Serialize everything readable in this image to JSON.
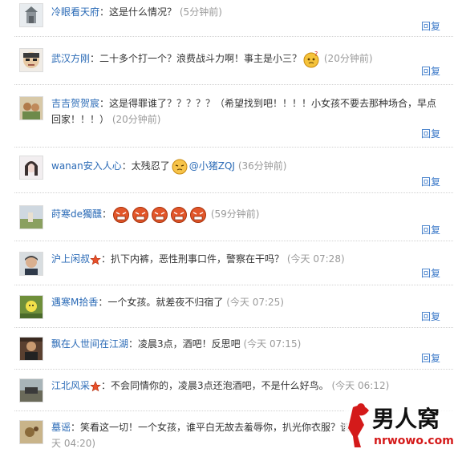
{
  "comments": [
    {
      "user": "冷眼看天府",
      "sep": "：",
      "text": "这是什么情况？",
      "time": "(5分钟前)",
      "reply": "回复"
    },
    {
      "user": "武汉方刚",
      "sep": "：",
      "text": "二十多个打一个？浪费战斗力啊！事主是小三？",
      "time": "(20分钟前)",
      "reply": "回复"
    },
    {
      "user": "吉吉贺贺宸",
      "sep": "：",
      "text_line1": "这是得罪谁了？？？？？（希望找到吧！！！！小女孩不要去那种场合，早点",
      "text_line2": "回家！！！）",
      "time": "(20分钟前)",
      "reply": "回复"
    },
    {
      "user": "wanan安入人心",
      "sep": "：",
      "text": "太残忍了",
      "mention": "@小猪ZQJ",
      "time": "(36分钟前)",
      "reply": "回复"
    },
    {
      "user": "莳寒de獨醺",
      "sep": "：",
      "time": "(59分钟前)",
      "reply": "回复"
    },
    {
      "user": "沪上闲叔",
      "sep": "：",
      "text": "扒下内裤，恶性刑事口件，警察在干吗？",
      "time": "(今天 07:28)",
      "reply": "回复"
    },
    {
      "user": "遇寒M拾香",
      "sep": "：",
      "text": "一个女孩。就差夜不归宿了",
      "time": "(今天 07:25)",
      "reply": "回复"
    },
    {
      "user": "飘在人世间在江湖",
      "sep": "：",
      "text": "凌晨3点，酒吧！反思吧",
      "time": "(今天 07:15)",
      "reply": "回复"
    },
    {
      "user": "江北风采",
      "sep": "：",
      "text": "不会同情你的，凌晨3点还泡酒吧，不是什么好鸟。",
      "time": "(今天 06:12)",
      "reply": "回复"
    },
    {
      "user": "墓谣",
      "sep": "：",
      "text_line1": "笑看这一切！一个女孩，谁平白无故去羞辱你，扒光你衣服？该",
      "text_line2": "天 04:20)"
    }
  ],
  "watermark": {
    "brand": "男人窝",
    "url": "nrwowo.com"
  }
}
